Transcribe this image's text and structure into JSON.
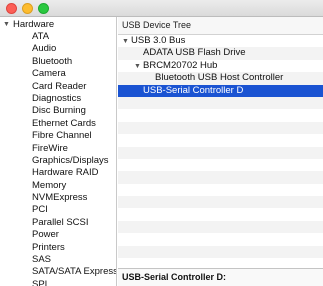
{
  "sidebar": {
    "section_label": "Hardware",
    "items": [
      "ATA",
      "Audio",
      "Bluetooth",
      "Camera",
      "Card Reader",
      "Diagnostics",
      "Disc Burning",
      "Ethernet Cards",
      "Fibre Channel",
      "FireWire",
      "Graphics/Displays",
      "Hardware RAID",
      "Memory",
      "NVMExpress",
      "PCI",
      "Parallel SCSI",
      "Power",
      "Printers",
      "SAS",
      "SATA/SATA Express",
      "SPI"
    ]
  },
  "main": {
    "header": "USB Device Tree",
    "tree": [
      {
        "label": "USB 3.0 Bus",
        "level": 0,
        "expanded": true
      },
      {
        "label": "ADATA USB Flash Drive",
        "level": 1
      },
      {
        "label": "BRCM20702 Hub",
        "level": 1,
        "expanded": true
      },
      {
        "label": "Bluetooth USB Host Controller",
        "level": 2
      },
      {
        "label": "USB-Serial Controller D",
        "level": 1,
        "selected": true
      }
    ],
    "details_title": "USB-Serial Controller D:"
  }
}
